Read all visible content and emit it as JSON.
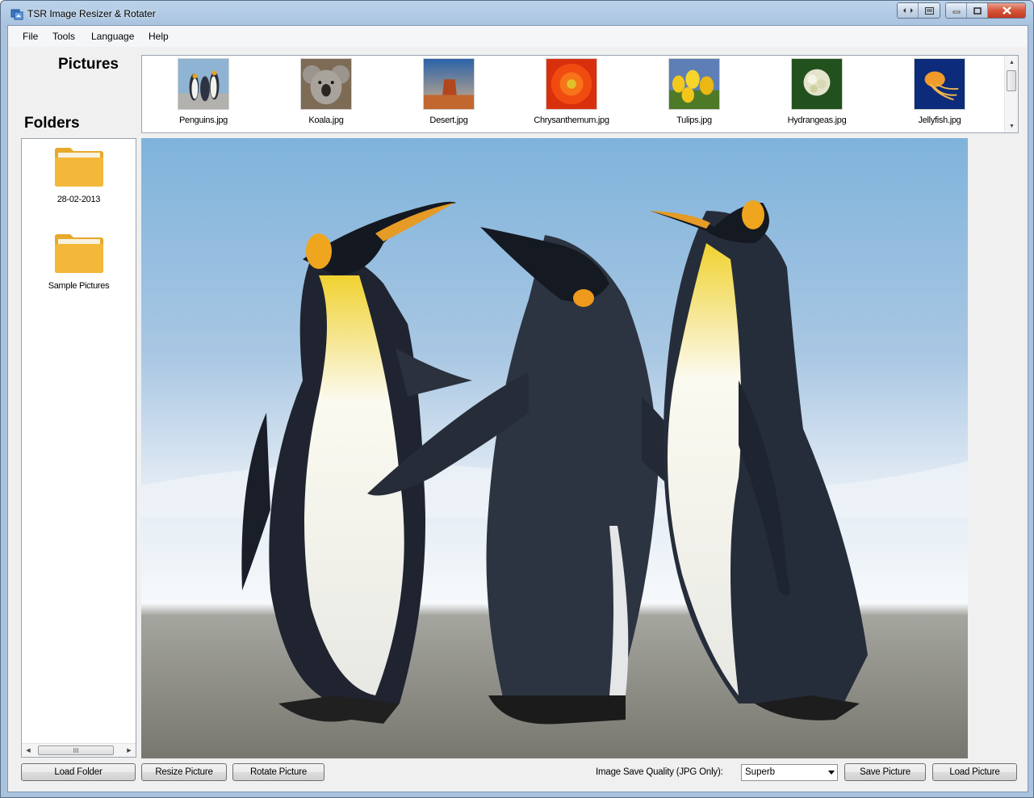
{
  "window": {
    "title": "TSR Image Resizer & Rotater"
  },
  "menu": [
    "File",
    "Tools",
    "Language",
    "Help"
  ],
  "sections": {
    "pictures": "Pictures",
    "folders": "Folders"
  },
  "thumbnails": [
    {
      "label": "Penguins.jpg",
      "icon": "penguins-thumbnail"
    },
    {
      "label": "Koala.jpg",
      "icon": "koala-thumbnail"
    },
    {
      "label": "Desert.jpg",
      "icon": "desert-thumbnail"
    },
    {
      "label": "Chrysanthemum.jpg",
      "icon": "chrysanthemum-thumbnail"
    },
    {
      "label": "Tulips.jpg",
      "icon": "tulips-thumbnail"
    },
    {
      "label": "Hydrangeas.jpg",
      "icon": "hydrangeas-thumbnail"
    },
    {
      "label": "Jellyfish.jpg",
      "icon": "jellyfish-thumbnail"
    }
  ],
  "folders": [
    {
      "label": "28-02-2013",
      "icon": "folder-icon"
    },
    {
      "label": "Sample Pictures",
      "icon": "folder-icon"
    }
  ],
  "toolbar": {
    "load_folder": "Load Folder",
    "resize_picture": "Resize Picture",
    "rotate_picture": "Rotate Picture",
    "quality_label": "Image Save Quality (JPG Only):",
    "quality_value": "Superb",
    "save_picture": "Save Picture",
    "load_picture": "Load Picture"
  },
  "colors": {
    "folder": "#f3b73a",
    "title_bar": "#a9c3df",
    "close_button": "#d6543a"
  }
}
